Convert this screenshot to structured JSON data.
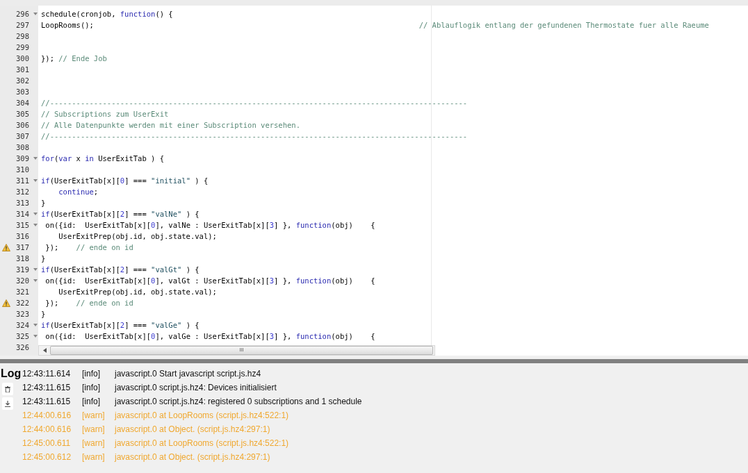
{
  "editor": {
    "lines": [
      {
        "number": "296",
        "fold": true,
        "warning": false,
        "code": [
          {
            "kind": "plain",
            "text": "schedule(cronjob, "
          },
          {
            "kind": "keyword",
            "text": "function"
          },
          {
            "kind": "plain",
            "text": "() {"
          }
        ]
      },
      {
        "number": "297",
        "fold": false,
        "warning": false,
        "code": [
          {
            "kind": "plain",
            "text": "LoopRooms();                                                                          "
          },
          {
            "kind": "comment",
            "text": "// Ablauflogik entlang der gefundenen Thermostate fuer alle Raeume"
          }
        ]
      },
      {
        "number": "298",
        "fold": false,
        "warning": false
      },
      {
        "number": "299",
        "fold": false,
        "warning": false
      },
      {
        "number": "300",
        "fold": false,
        "warning": false,
        "code": [
          {
            "kind": "plain",
            "text": "}); "
          },
          {
            "kind": "comment",
            "text": "// Ende Job"
          }
        ]
      },
      {
        "number": "301",
        "fold": false,
        "warning": false
      },
      {
        "number": "302",
        "fold": false,
        "warning": false
      },
      {
        "number": "303",
        "fold": false,
        "warning": false
      },
      {
        "number": "304",
        "fold": false,
        "warning": false,
        "code": [
          {
            "kind": "comment",
            "text": "//-----------------------------------------------------------------------------------------------"
          }
        ]
      },
      {
        "number": "305",
        "fold": false,
        "warning": false,
        "code": [
          {
            "kind": "comment",
            "text": "// Subscriptions zum UserExit"
          }
        ]
      },
      {
        "number": "306",
        "fold": false,
        "warning": false,
        "code": [
          {
            "kind": "comment",
            "text": "// Alle Datenpunkte werden mit einer Subscription versehen."
          }
        ]
      },
      {
        "number": "307",
        "fold": false,
        "warning": false,
        "code": [
          {
            "kind": "comment",
            "text": "//-----------------------------------------------------------------------------------------------"
          }
        ]
      },
      {
        "number": "308",
        "fold": false,
        "warning": false
      },
      {
        "number": "309",
        "fold": true,
        "warning": false,
        "code": [
          {
            "kind": "keyword",
            "text": "for"
          },
          {
            "kind": "plain",
            "text": "("
          },
          {
            "kind": "keyword",
            "text": "var"
          },
          {
            "kind": "plain",
            "text": " x "
          },
          {
            "kind": "keyword",
            "text": "in"
          },
          {
            "kind": "plain",
            "text": " UserExitTab ) {"
          }
        ]
      },
      {
        "number": "310",
        "fold": false,
        "warning": false
      },
      {
        "number": "311",
        "fold": true,
        "warning": false,
        "code": [
          {
            "kind": "keyword",
            "text": "if"
          },
          {
            "kind": "plain",
            "text": "(UserExitTab[x]["
          },
          {
            "kind": "number",
            "text": "0"
          },
          {
            "kind": "plain",
            "text": "] === "
          },
          {
            "kind": "string",
            "text": "\"initial\""
          },
          {
            "kind": "plain",
            "text": " ) {"
          }
        ]
      },
      {
        "number": "312",
        "fold": false,
        "warning": false,
        "code": [
          {
            "kind": "keyword",
            "text": "    continue"
          },
          {
            "kind": "plain",
            "text": ";"
          }
        ]
      },
      {
        "number": "313",
        "fold": false,
        "warning": false,
        "code": [
          {
            "kind": "plain",
            "text": "}"
          }
        ]
      },
      {
        "number": "314",
        "fold": true,
        "warning": false,
        "code": [
          {
            "kind": "keyword",
            "text": "if"
          },
          {
            "kind": "plain",
            "text": "(UserExitTab[x]["
          },
          {
            "kind": "number",
            "text": "2"
          },
          {
            "kind": "plain",
            "text": "] === "
          },
          {
            "kind": "string",
            "text": "\"valNe\""
          },
          {
            "kind": "plain",
            "text": " ) {"
          }
        ]
      },
      {
        "number": "315",
        "fold": true,
        "warning": false,
        "code": [
          {
            "kind": "plain",
            "text": " on({id:  UserExitTab[x]["
          },
          {
            "kind": "number",
            "text": "0"
          },
          {
            "kind": "plain",
            "text": "], valNe : UserExitTab[x]["
          },
          {
            "kind": "number",
            "text": "3"
          },
          {
            "kind": "plain",
            "text": "] }, "
          },
          {
            "kind": "keyword",
            "text": "function"
          },
          {
            "kind": "plain",
            "text": "(obj)    {"
          }
        ]
      },
      {
        "number": "316",
        "fold": false,
        "warning": false,
        "code": [
          {
            "kind": "plain",
            "text": "    UserExitPrep(obj.id, obj.state.val);"
          }
        ]
      },
      {
        "number": "317",
        "fold": false,
        "warning": true,
        "code": [
          {
            "kind": "plain",
            "text": " });    "
          },
          {
            "kind": "comment",
            "text": "// ende on id"
          }
        ]
      },
      {
        "number": "318",
        "fold": false,
        "warning": false,
        "code": [
          {
            "kind": "plain",
            "text": "}"
          }
        ]
      },
      {
        "number": "319",
        "fold": true,
        "warning": false,
        "code": [
          {
            "kind": "keyword",
            "text": "if"
          },
          {
            "kind": "plain",
            "text": "(UserExitTab[x]["
          },
          {
            "kind": "number",
            "text": "2"
          },
          {
            "kind": "plain",
            "text": "] === "
          },
          {
            "kind": "string",
            "text": "\"valGt\""
          },
          {
            "kind": "plain",
            "text": " ) {"
          }
        ]
      },
      {
        "number": "320",
        "fold": true,
        "warning": false,
        "code": [
          {
            "kind": "plain",
            "text": " on({id:  UserExitTab[x]["
          },
          {
            "kind": "number",
            "text": "0"
          },
          {
            "kind": "plain",
            "text": "], valGt : UserExitTab[x]["
          },
          {
            "kind": "number",
            "text": "3"
          },
          {
            "kind": "plain",
            "text": "] }, "
          },
          {
            "kind": "keyword",
            "text": "function"
          },
          {
            "kind": "plain",
            "text": "(obj)    {"
          }
        ]
      },
      {
        "number": "321",
        "fold": false,
        "warning": false,
        "code": [
          {
            "kind": "plain",
            "text": "    UserExitPrep(obj.id, obj.state.val);"
          }
        ]
      },
      {
        "number": "322",
        "fold": false,
        "warning": true,
        "code": [
          {
            "kind": "plain",
            "text": " });    "
          },
          {
            "kind": "comment",
            "text": "// ende on id"
          }
        ]
      },
      {
        "number": "323",
        "fold": false,
        "warning": false,
        "code": [
          {
            "kind": "plain",
            "text": "}"
          }
        ]
      },
      {
        "number": "324",
        "fold": true,
        "warning": false,
        "code": [
          {
            "kind": "keyword",
            "text": "if"
          },
          {
            "kind": "plain",
            "text": "(UserExitTab[x]["
          },
          {
            "kind": "number",
            "text": "2"
          },
          {
            "kind": "plain",
            "text": "] === "
          },
          {
            "kind": "string",
            "text": "\"valGe\""
          },
          {
            "kind": "plain",
            "text": " ) {"
          }
        ]
      },
      {
        "number": "325",
        "fold": true,
        "warning": false,
        "code": [
          {
            "kind": "plain",
            "text": " on({id:  UserExitTab[x]["
          },
          {
            "kind": "number",
            "text": "0"
          },
          {
            "kind": "plain",
            "text": "], valGe : UserExitTab[x]["
          },
          {
            "kind": "number",
            "text": "3"
          },
          {
            "kind": "plain",
            "text": "] }, "
          },
          {
            "kind": "keyword",
            "text": "function"
          },
          {
            "kind": "plain",
            "text": "(obj)    {"
          }
        ]
      },
      {
        "number": "326",
        "fold": false,
        "warning": false
      }
    ],
    "scrollbar_grip": "III"
  },
  "log": {
    "title": "Log",
    "entries": [
      {
        "kind": "info",
        "time": "12:43:11.614",
        "level": "[info]",
        "message": "javascript.0 Start javascript script.js.hz4"
      },
      {
        "kind": "info",
        "time": "12:43:11.615",
        "level": "[info]",
        "message": "javascript.0 script.js.hz4: Devices initialisiert"
      },
      {
        "kind": "info",
        "time": "12:43:11.615",
        "level": "[info]",
        "message": "javascript.0 script.js.hz4: registered 0 subscriptions and 1 schedule"
      },
      {
        "kind": "warn",
        "time": "12:44:00.616",
        "level": "[warn]",
        "message": "javascript.0 at LoopRooms (script.js.hz4:522:1)"
      },
      {
        "kind": "warn",
        "time": "12:44:00.616",
        "level": "[warn]",
        "message": "javascript.0 at Object. (script.js.hz4:297:1)"
      },
      {
        "kind": "warn",
        "time": "12:45:00.611",
        "level": "[warn]",
        "message": "javascript.0 at LoopRooms (script.js.hz4:522:1)"
      },
      {
        "kind": "warn",
        "time": "12:45:00.612",
        "level": "[warn]",
        "message": "javascript.0 at Object. (script.js.hz4:297:1)"
      }
    ]
  }
}
